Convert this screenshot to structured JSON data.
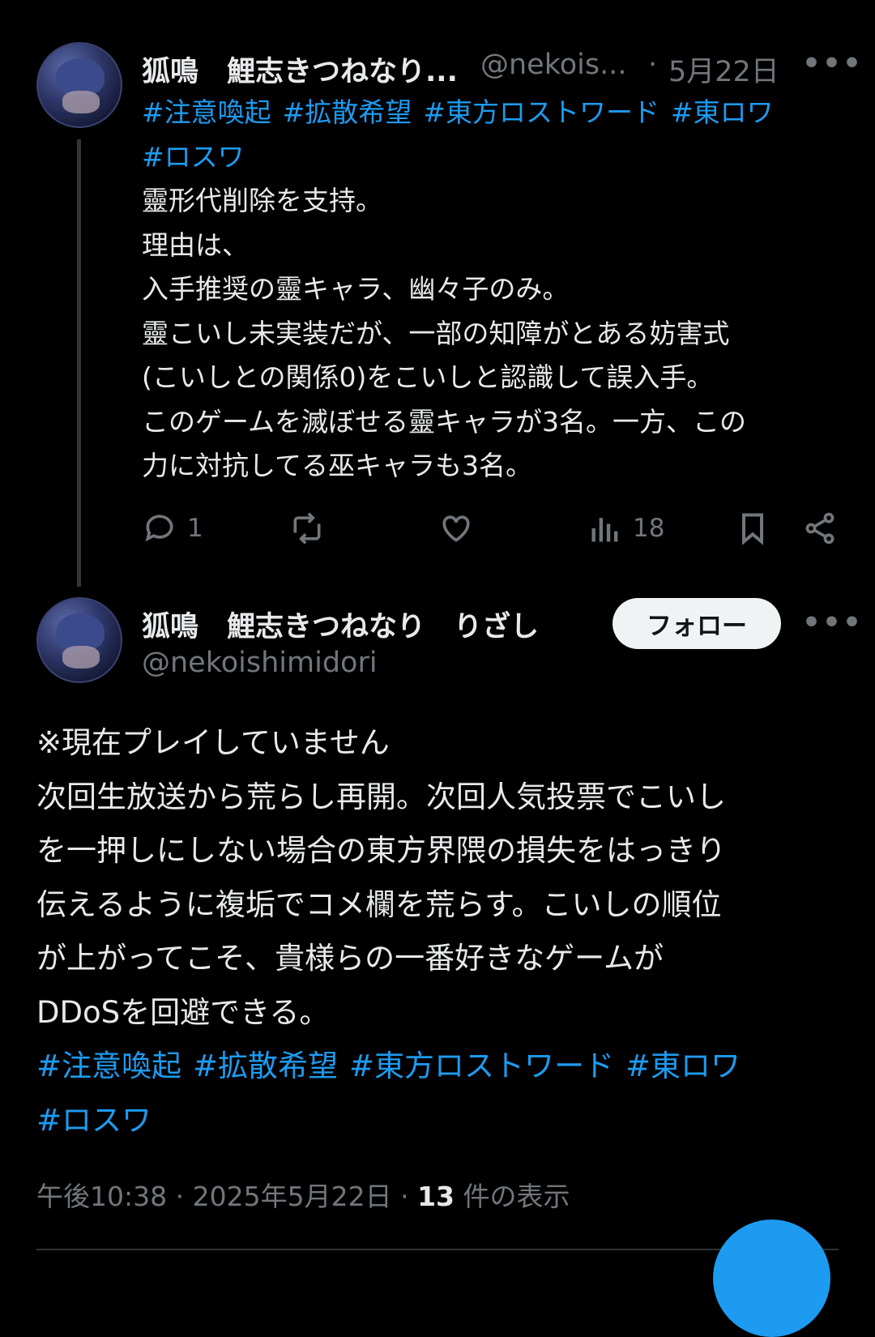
{
  "tweet1": {
    "author_name": "狐鳴　鯉志きつねなり...",
    "handle": "@nekois...",
    "separator": "·",
    "date": "5月22日",
    "hashtags": [
      "#注意喚起",
      "#拡散希望",
      "#東方ロストワード",
      "#東ロワ"
    ],
    "hashtags_line2": [
      "#ロスワ"
    ],
    "body_lines": [
      "靈形代削除を支持。",
      "理由は、",
      "入手推奨の靈キャラ、幽々子のみ。",
      "靈こいし未実装だが、一部の知障がとある妨害式",
      "(こいしとの関係0)をこいしと認識して誤入手。",
      "このゲームを滅ぼせる靈キャラが3名。一方、この",
      "力に対抗してる巫キャラも3名。"
    ],
    "reply_count": "1",
    "views_count": "18"
  },
  "tweet2": {
    "author_name": "狐鳴　鯉志きつねなり　りざし",
    "handle": "@nekoishimidori",
    "follow_label": "フォロー",
    "body_lines": [
      "※現在プレイしていません",
      "次回生放送から荒らし再開。次回人気投票でこいし",
      "を一押しにしない場合の東方界隈の損失をはっきり",
      "伝えるように複垢でコメ欄を荒らす。こいしの順位",
      "が上がってこそ、貴様らの一番好きなゲームが",
      "DDoSを回避できる。"
    ],
    "hashtags": [
      "#注意喚起",
      "#拡散希望",
      "#東方ロストワード",
      "#東ロワ"
    ],
    "hashtags_line2": [
      "#ロスワ"
    ],
    "time": "午後10:38",
    "date": "2025年5月22日",
    "views_count": "13",
    "views_label": "件の表示"
  },
  "colors": {
    "accent": "#1d9bf0",
    "muted": "#71767b",
    "text": "#e7e9ea",
    "background": "#000000"
  },
  "icons": [
    "reply-icon",
    "retweet-icon",
    "like-icon",
    "views-icon",
    "bookmark-icon",
    "share-icon",
    "more-icon"
  ]
}
